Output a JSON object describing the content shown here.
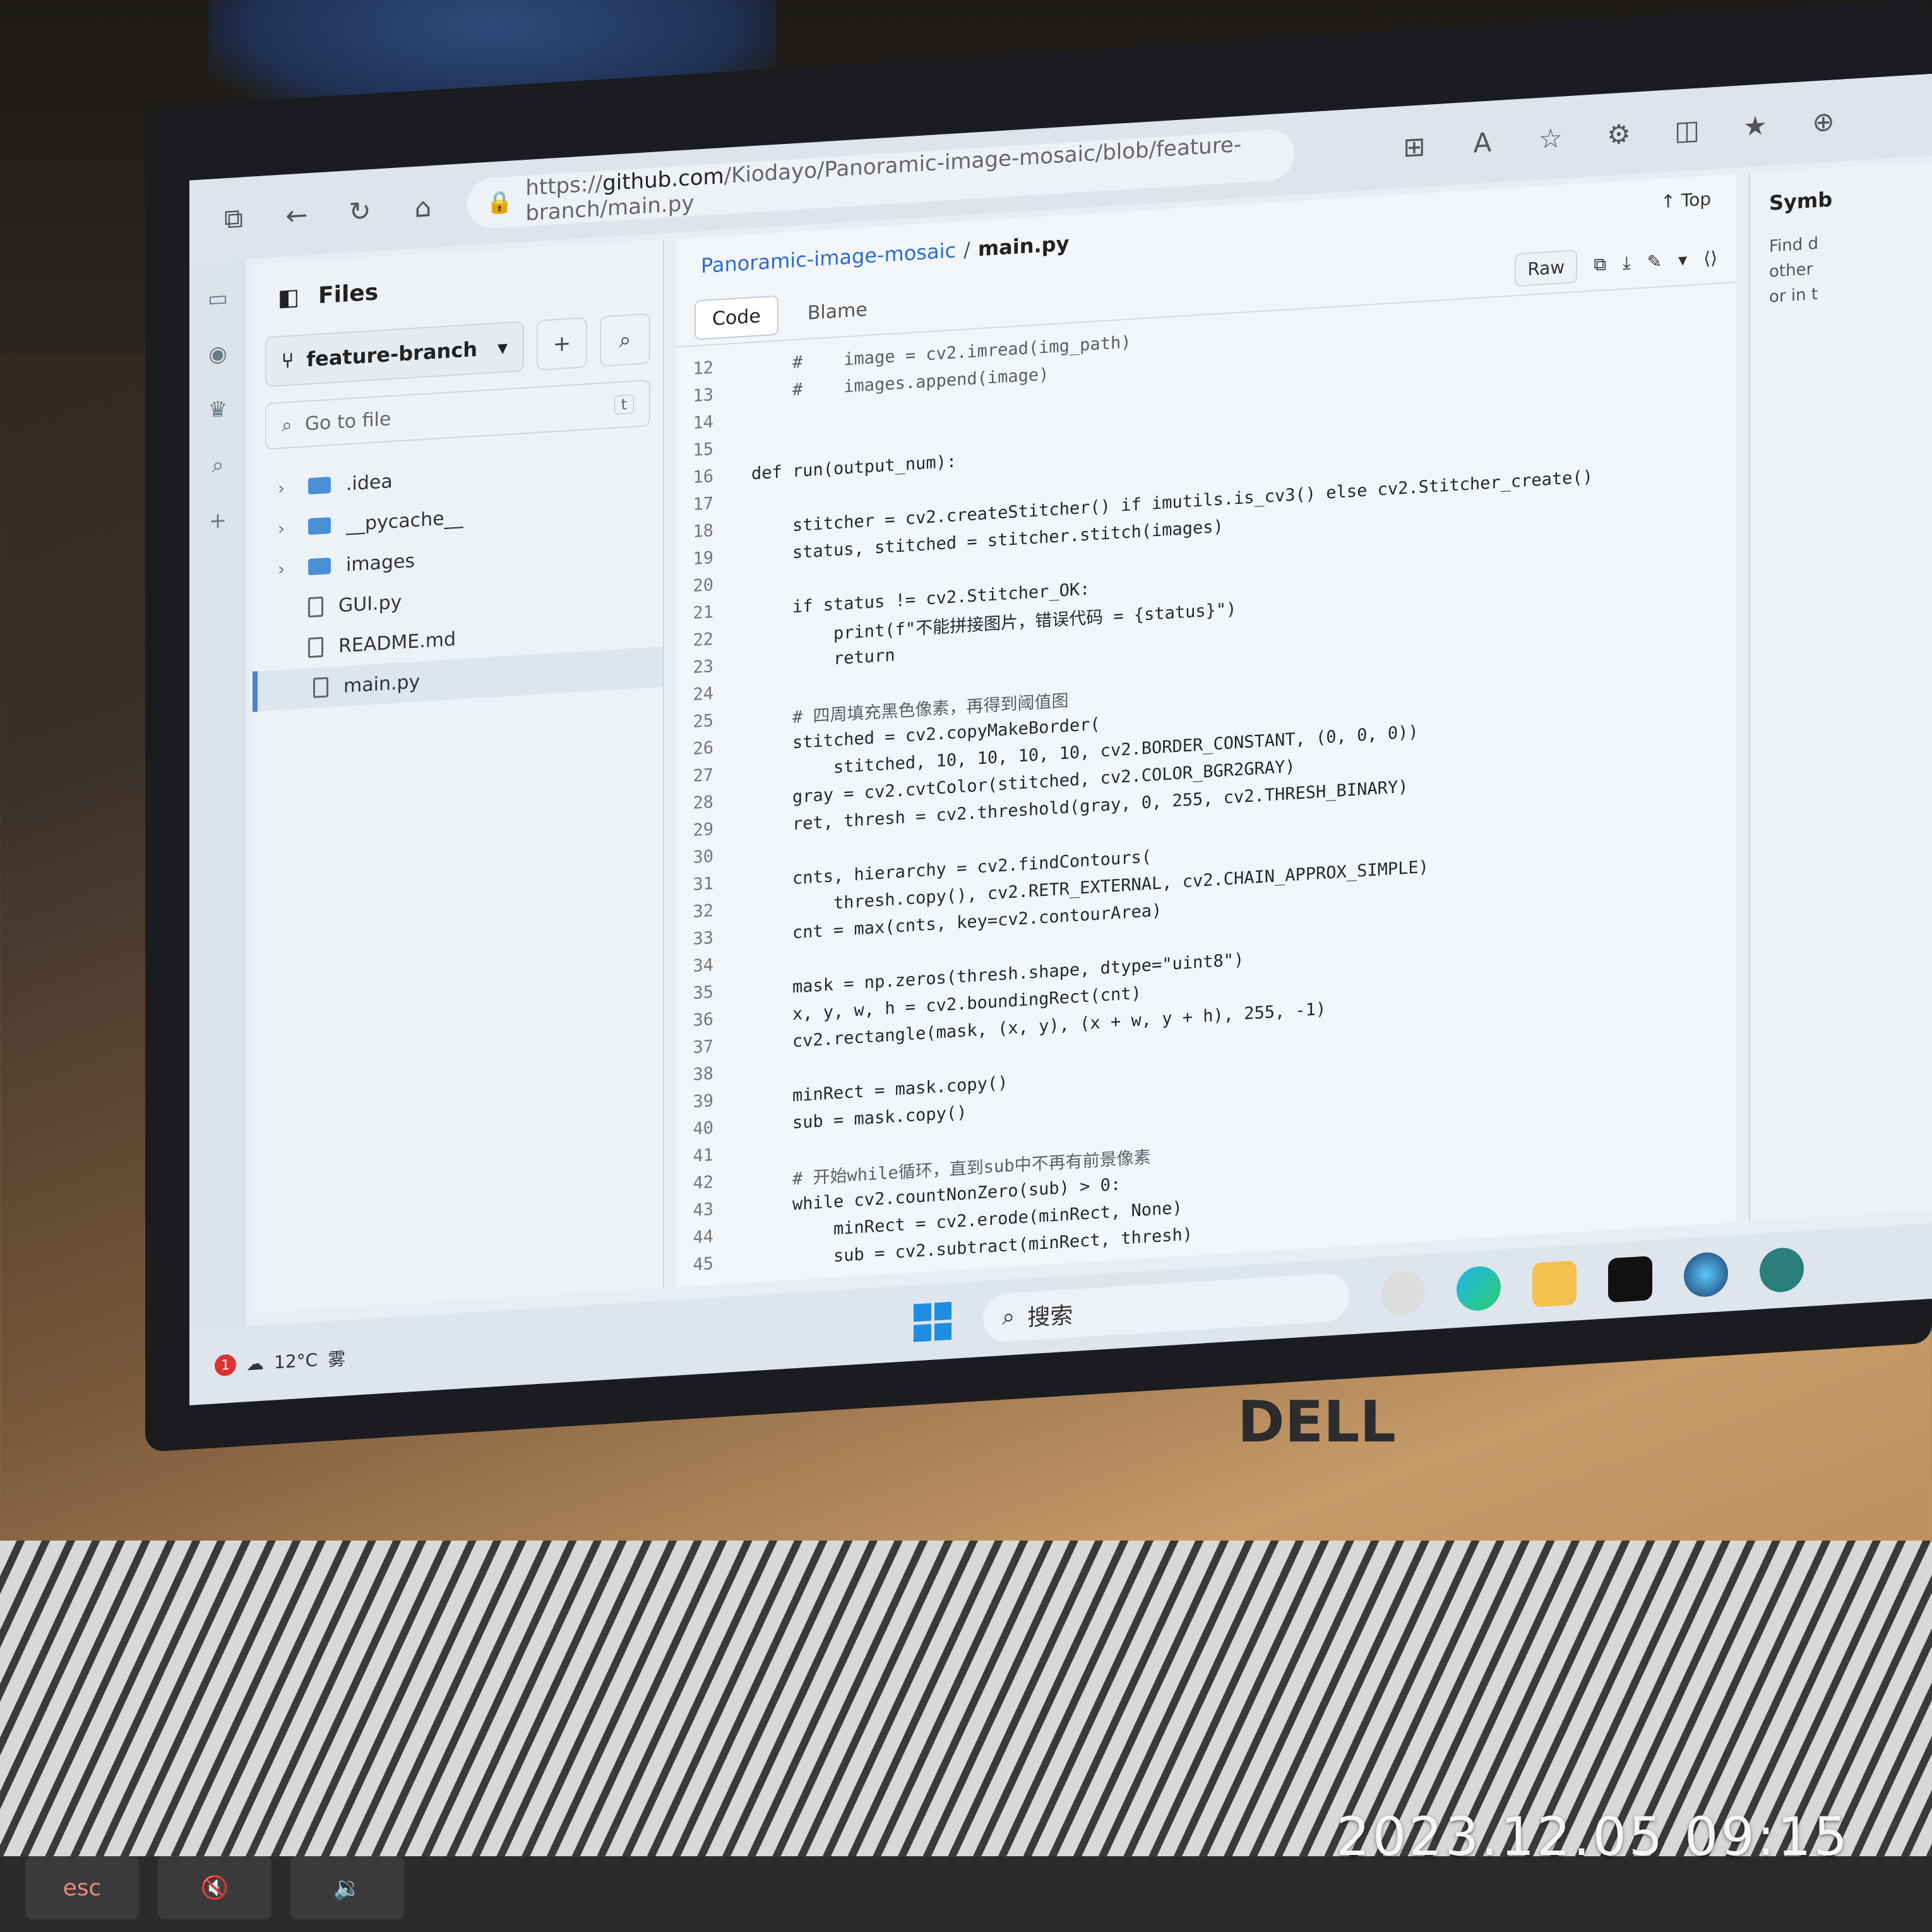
{
  "browser": {
    "url_scheme": "https://",
    "url_host": "github.com",
    "url_path": "/Kiodayo/Panoramic-image-mosaic/blob/feature-branch/main.py"
  },
  "files_panel": {
    "title": "Files",
    "branch": "feature-branch",
    "goto_placeholder": "Go to file",
    "goto_key": "t",
    "items": [
      {
        "name": ".idea",
        "type": "folder"
      },
      {
        "name": "__pycache__",
        "type": "folder"
      },
      {
        "name": "images",
        "type": "folder"
      },
      {
        "name": "GUI.py",
        "type": "file"
      },
      {
        "name": "README.md",
        "type": "file"
      },
      {
        "name": "main.py",
        "type": "file"
      }
    ]
  },
  "breadcrumb": {
    "repo": "Panoramic-image-mosaic",
    "sep": "/",
    "file": "main.py"
  },
  "top_link": "Top",
  "tabs": {
    "code": "Code",
    "blame": "Blame"
  },
  "actions": {
    "raw": "Raw"
  },
  "code_lines": [
    {
      "n": "12",
      "t": "    #    image = cv2.imread(img_path)"
    },
    {
      "n": "13",
      "t": "    #    images.append(image)"
    },
    {
      "n": "14",
      "t": ""
    },
    {
      "n": "15",
      "t": ""
    },
    {
      "n": "16",
      "t": "def run(output_num):"
    },
    {
      "n": "17",
      "t": ""
    },
    {
      "n": "18",
      "t": "    stitcher = cv2.createStitcher() if imutils.is_cv3() else cv2.Stitcher_create()"
    },
    {
      "n": "19",
      "t": "    status, stitched = stitcher.stitch(images)"
    },
    {
      "n": "20",
      "t": ""
    },
    {
      "n": "21",
      "t": "    if status != cv2.Stitcher_OK:"
    },
    {
      "n": "22",
      "t": "        print(f\"不能拼接图片，错误代码 = {status}\")"
    },
    {
      "n": "23",
      "t": "        return"
    },
    {
      "n": "24",
      "t": ""
    },
    {
      "n": "25",
      "t": "    # 四周填充黑色像素，再得到阈值图"
    },
    {
      "n": "26",
      "t": "    stitched = cv2.copyMakeBorder("
    },
    {
      "n": "27",
      "t": "        stitched, 10, 10, 10, 10, cv2.BORDER_CONSTANT, (0, 0, 0))"
    },
    {
      "n": "28",
      "t": "    gray = cv2.cvtColor(stitched, cv2.COLOR_BGR2GRAY)"
    },
    {
      "n": "29",
      "t": "    ret, thresh = cv2.threshold(gray, 0, 255, cv2.THRESH_BINARY)"
    },
    {
      "n": "30",
      "t": ""
    },
    {
      "n": "31",
      "t": "    cnts, hierarchy = cv2.findContours("
    },
    {
      "n": "32",
      "t": "        thresh.copy(), cv2.RETR_EXTERNAL, cv2.CHAIN_APPROX_SIMPLE)"
    },
    {
      "n": "33",
      "t": "    cnt = max(cnts, key=cv2.contourArea)"
    },
    {
      "n": "34",
      "t": ""
    },
    {
      "n": "35",
      "t": "    mask = np.zeros(thresh.shape, dtype=\"uint8\")"
    },
    {
      "n": "36",
      "t": "    x, y, w, h = cv2.boundingRect(cnt)"
    },
    {
      "n": "37",
      "t": "    cv2.rectangle(mask, (x, y), (x + w, y + h), 255, -1)"
    },
    {
      "n": "38",
      "t": ""
    },
    {
      "n": "39",
      "t": "    minRect = mask.copy()"
    },
    {
      "n": "40",
      "t": "    sub = mask.copy()"
    },
    {
      "n": "41",
      "t": ""
    },
    {
      "n": "42",
      "t": "    # 开始while循环，直到sub中不再有前景像素"
    },
    {
      "n": "43",
      "t": "    while cv2.countNonZero(sub) > 0:"
    },
    {
      "n": "44",
      "t": "        minRect = cv2.erode(minRect, None)"
    },
    {
      "n": "45",
      "t": "        sub = cv2.subtract(minRect, thresh)"
    }
  ],
  "symbols": {
    "title": "Symb",
    "desc1": "Find d",
    "desc2": "other",
    "desc3": "or in t"
  },
  "taskbar": {
    "badge": "1",
    "temp": "12°C",
    "weather": "雾",
    "search": "搜索"
  },
  "keys": [
    "esc",
    "",
    ""
  ],
  "photo_timestamp": "2023.12.05  09:15",
  "brand": "DELL"
}
